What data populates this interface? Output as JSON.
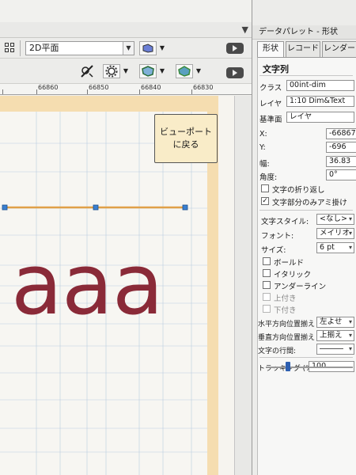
{
  "view": {
    "view_mode": "2D平面",
    "viewport_return_button": "ビューポートに戻る",
    "canvas_text": "aaa",
    "canvas_text_color": "#8a2a38"
  },
  "ruler": {
    "labels": [
      "66860",
      "66850",
      "66840",
      "66830"
    ]
  },
  "palette": {
    "title": "データパレット - 形状",
    "tabs": [
      "形状",
      "レコード",
      "レンダー"
    ],
    "object_type": "文字列",
    "class_label": "クラス",
    "class_value": "00int-dim",
    "layer_label": "レイヤ",
    "layer_value": "1:10 Dim&Text",
    "plane_label": "基準面",
    "plane_value": "レイヤ",
    "x_label": "X:",
    "x_value": "-66867",
    "y_label": "Y:",
    "y_value": "-696",
    "width_label": "幅:",
    "width_value": "36.83",
    "angle_label": "角度:",
    "angle_value": "0°",
    "wrap_text_label": "文字の折り返し",
    "wrap_text_checked": false,
    "hatch_text_only_label": "文字部分のみアミ掛け",
    "hatch_text_only_checked": true,
    "text_style_label": "文字スタイル:",
    "text_style_value": "<なし>",
    "font_label": "フォント:",
    "font_value": "メイリオ",
    "size_label": "サイズ:",
    "size_value": "6 pt",
    "bold_label": "ボールド",
    "italic_label": "イタリック",
    "underline_label": "アンダーライン",
    "superscript_label": "上付き",
    "subscript_label": "下付き",
    "h_align_label": "水平方向位置揃え",
    "h_align_value": "左よせ",
    "v_align_label": "垂直方向位置揃え",
    "v_align_value": "上揃え",
    "line_spacing_label": "文字の行間:",
    "tracking_label": "トラッキング (%)",
    "tracking_value": "100",
    "tracking_fraction": 0.25
  },
  "colors": {
    "paper_margin": "#f5ddb0",
    "dimension_line": "#e0a048",
    "handle": "#3a7fd0",
    "grid": "#b9cde0",
    "slider_thumb": "#2d5fb0"
  }
}
